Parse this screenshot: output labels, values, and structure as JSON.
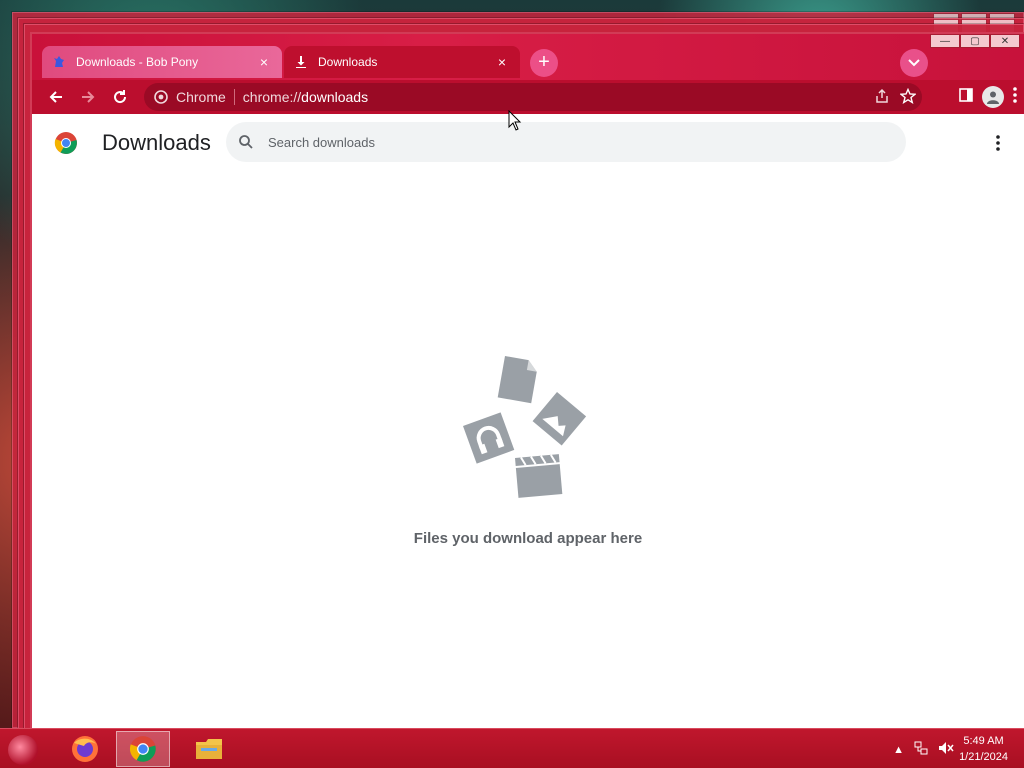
{
  "browser": {
    "tabs": [
      {
        "label": "Downloads - Bob Pony",
        "active": false,
        "icon": "pony-icon"
      },
      {
        "label": "Downloads",
        "active": true,
        "icon": "download-icon"
      }
    ],
    "new_tab_symbol": "+",
    "omnibox": {
      "site_label": "Chrome",
      "url_scheme": "chrome://",
      "url_path": "downloads"
    }
  },
  "page": {
    "title": "Downloads",
    "search_placeholder": "Search downloads",
    "empty_message": "Files you download appear here"
  },
  "taskbar": {
    "apps": [
      "firefox-icon",
      "chrome-icon",
      "file-explorer-icon"
    ],
    "time": "5:49 AM",
    "date": "1/21/2024"
  },
  "colors": {
    "accent": "#b60d2b",
    "tab_pink": "#e9689a",
    "page_bg": "#ffffff",
    "muted_text": "#5f6368",
    "illustration_gray": "#9aa0a6"
  }
}
